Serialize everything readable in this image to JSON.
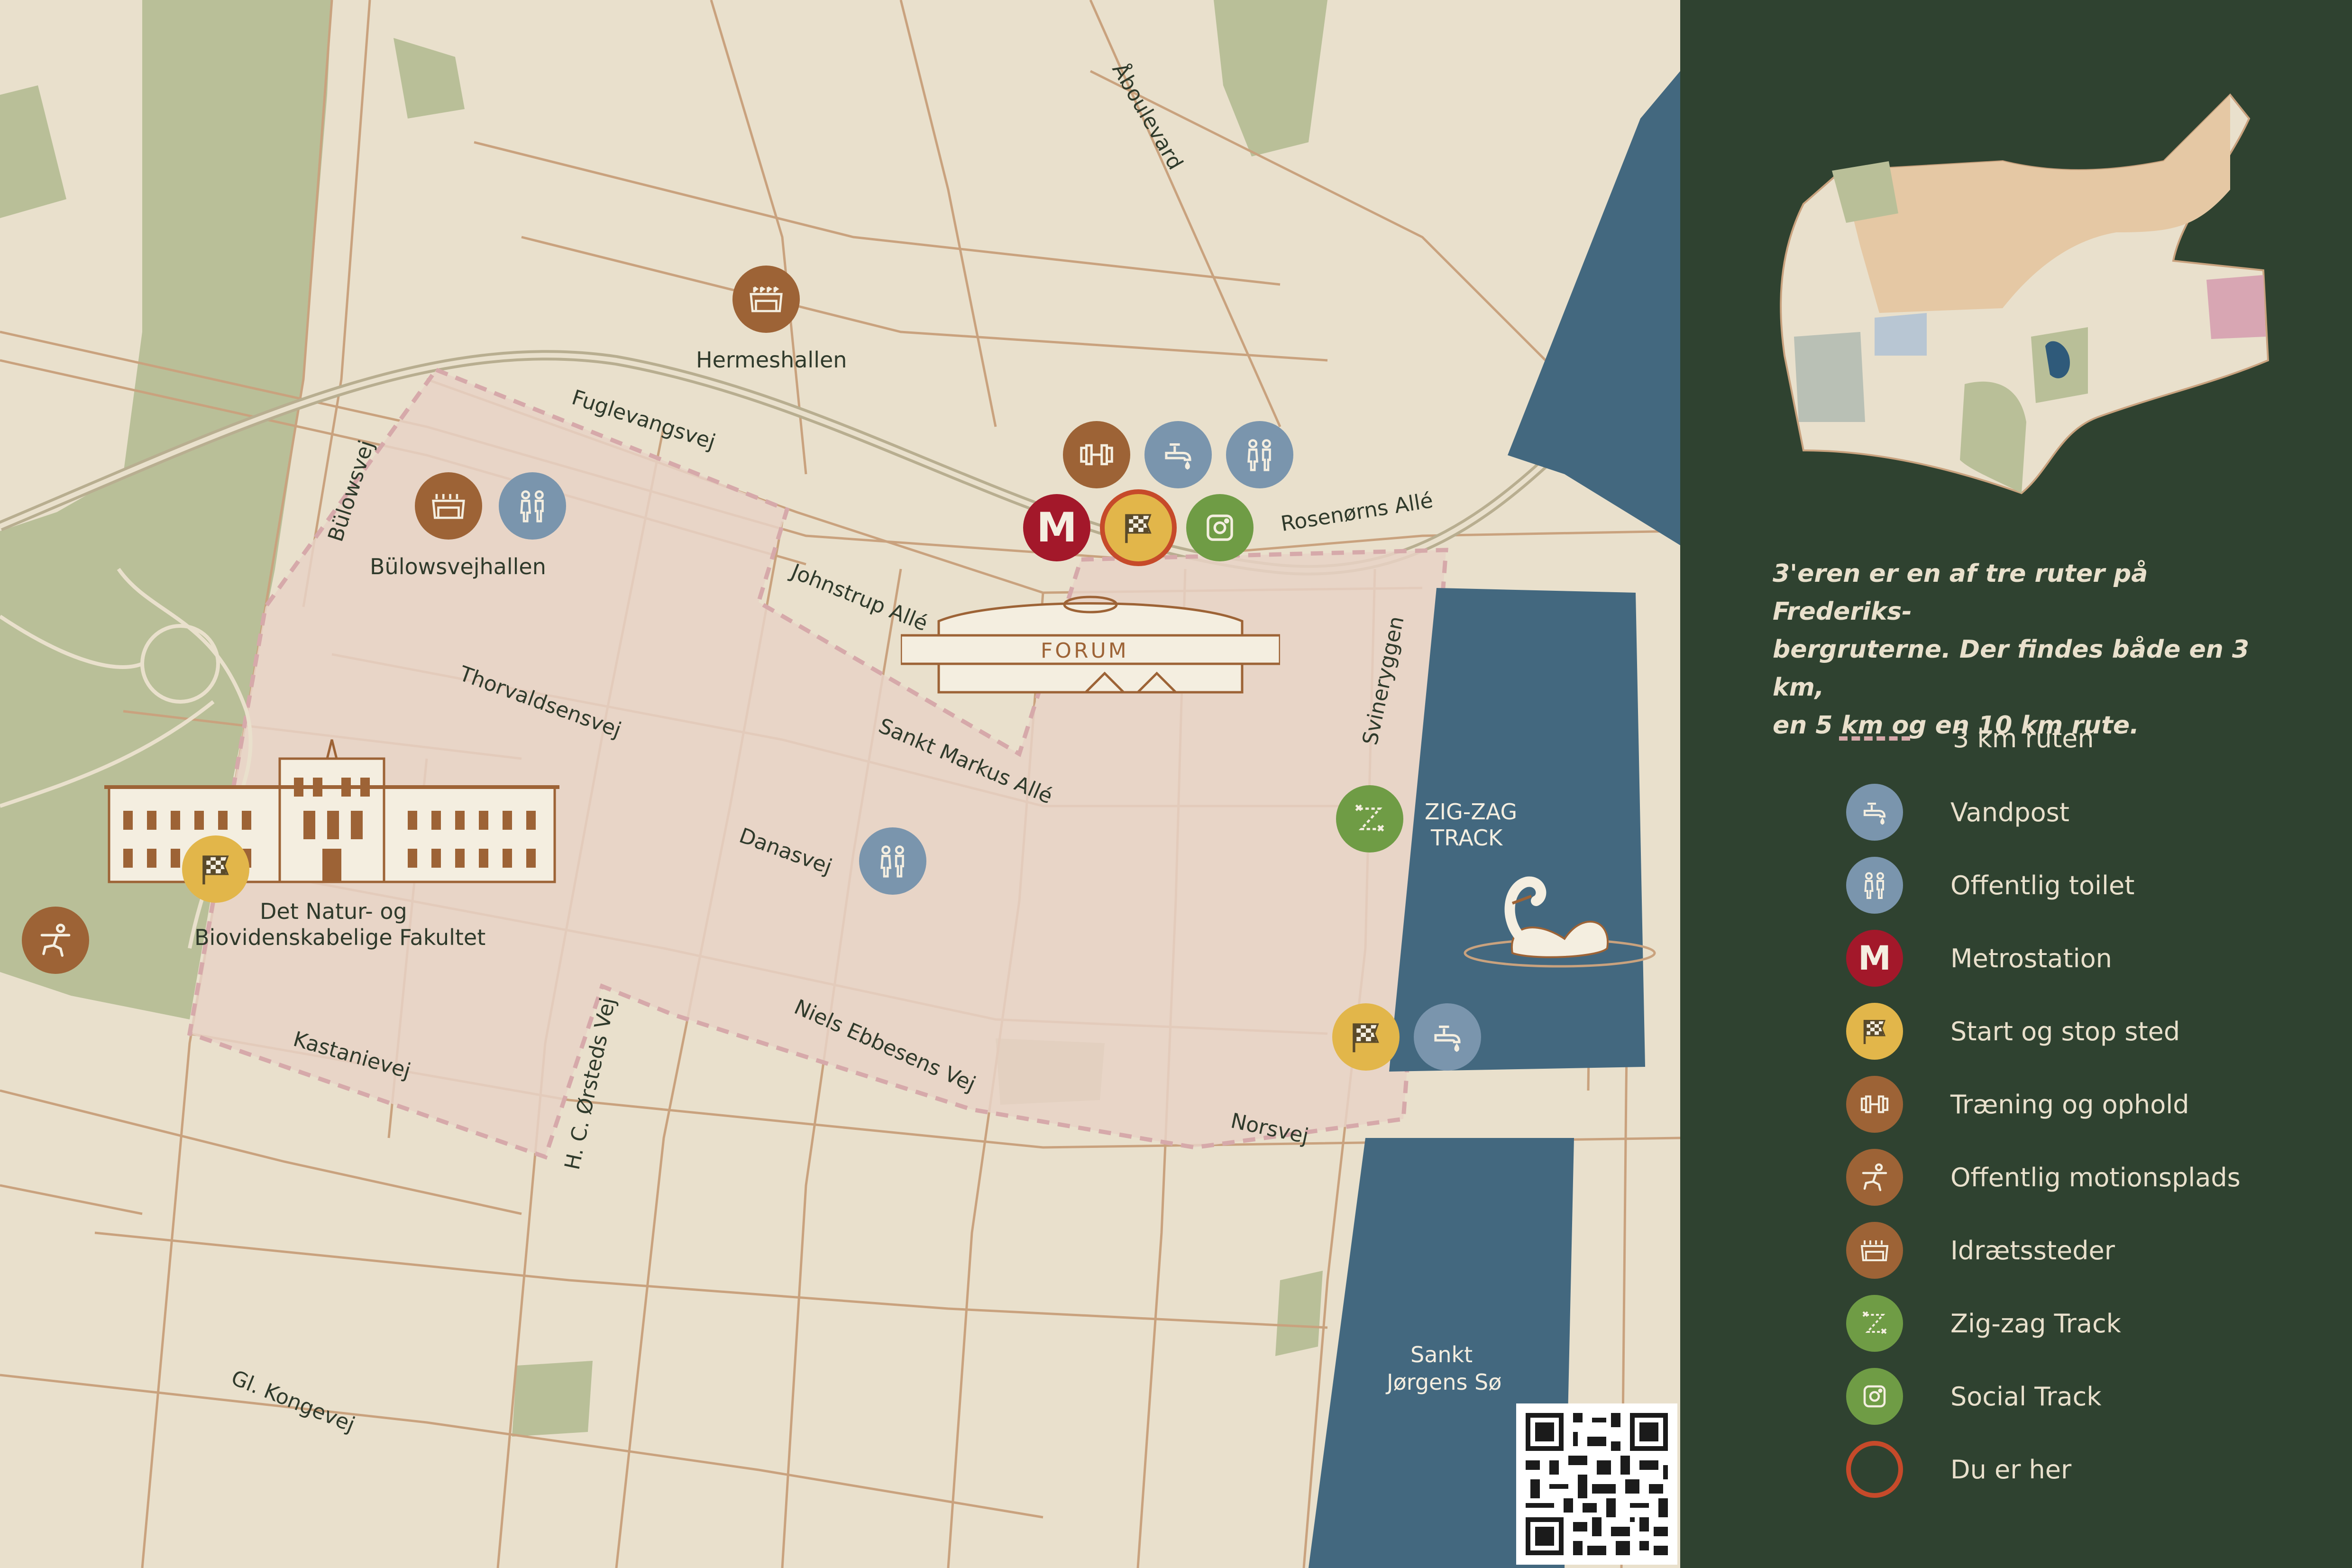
{
  "streets": {
    "aboulevard": "Åboulevard",
    "fuglevangsvej": "Fuglevangsvej",
    "bulowsvej": "Bülowsvej",
    "rosenorns_alle": "Rosenørns Allé",
    "johnstrup_alle": "Johnstrup Allé",
    "thorvaldsensvej": "Thorvaldsensvej",
    "sankt_markus_alle": "Sankt Markus Allé",
    "svineryggen": "Svineryggen",
    "danasvej": "Danasvej",
    "niels_ebbesens_vej": "Niels Ebbesens Vej",
    "kastanievej": "Kastanievej",
    "hc_orsteds_vej": "H. C. Ørsteds Vej",
    "norsvej": "Norsvej",
    "gl_kongevej": "Gl. Kongevej"
  },
  "places": {
    "hermeshallen": "Hermeshallen",
    "bulowsvejhallen": "Bülowsvejhallen",
    "forum": "FORUM",
    "faculty_line1": "Det Natur- og",
    "faculty_line2": "Biovidenskabelige Fakultet",
    "zigzag_line1": "ZIG-ZAG",
    "zigzag_line2": "TRACK",
    "lake_line1": "Sankt",
    "lake_line2": "Jørgens Sø"
  },
  "metro_letter": "M",
  "panel": {
    "blurb_line1": "3'eren er en af tre ruter på Frederiks-",
    "blurb_line2": "bergruterne. Der findes både en 3 km,",
    "blurb_line3": "en 5 km og en 10 km rute."
  },
  "legend": [
    {
      "label": "3 km ruten",
      "icon": "dashed-route-line"
    },
    {
      "label": "Vandpost",
      "icon": "water-tap-icon"
    },
    {
      "label": "Offentlig toilet",
      "icon": "toilet-icon"
    },
    {
      "label": "Metrostation",
      "icon": "metro-icon"
    },
    {
      "label": "Start og stop sted",
      "icon": "checkered-flag-icon"
    },
    {
      "label": "Træning og ophold",
      "icon": "dumbbell-icon"
    },
    {
      "label": "Offentlig motionsplads",
      "icon": "exercise-figure-icon"
    },
    {
      "label": "Idrætssteder",
      "icon": "stadium-icon"
    },
    {
      "label": "Zig-zag Track",
      "icon": "zigzag-icon"
    },
    {
      "label": "Social Track",
      "icon": "camera-icon"
    },
    {
      "label": "Du er her",
      "icon": "you-are-here-ring"
    }
  ],
  "colors": {
    "background": "#e9e0cc",
    "road": "#c9a27e",
    "park": "#b9bf98",
    "water": "#43687f",
    "route_area": "#e8d2c6",
    "route_dash": "#d6a9aa",
    "panel": "#2f4230",
    "blue_icon": "#7a95ad",
    "metro_red": "#a3182a",
    "start_yellow": "#e2b64a",
    "brown_icon": "#9d6336",
    "green_icon": "#6f9c45",
    "you_are_here": "#c64a2a"
  }
}
